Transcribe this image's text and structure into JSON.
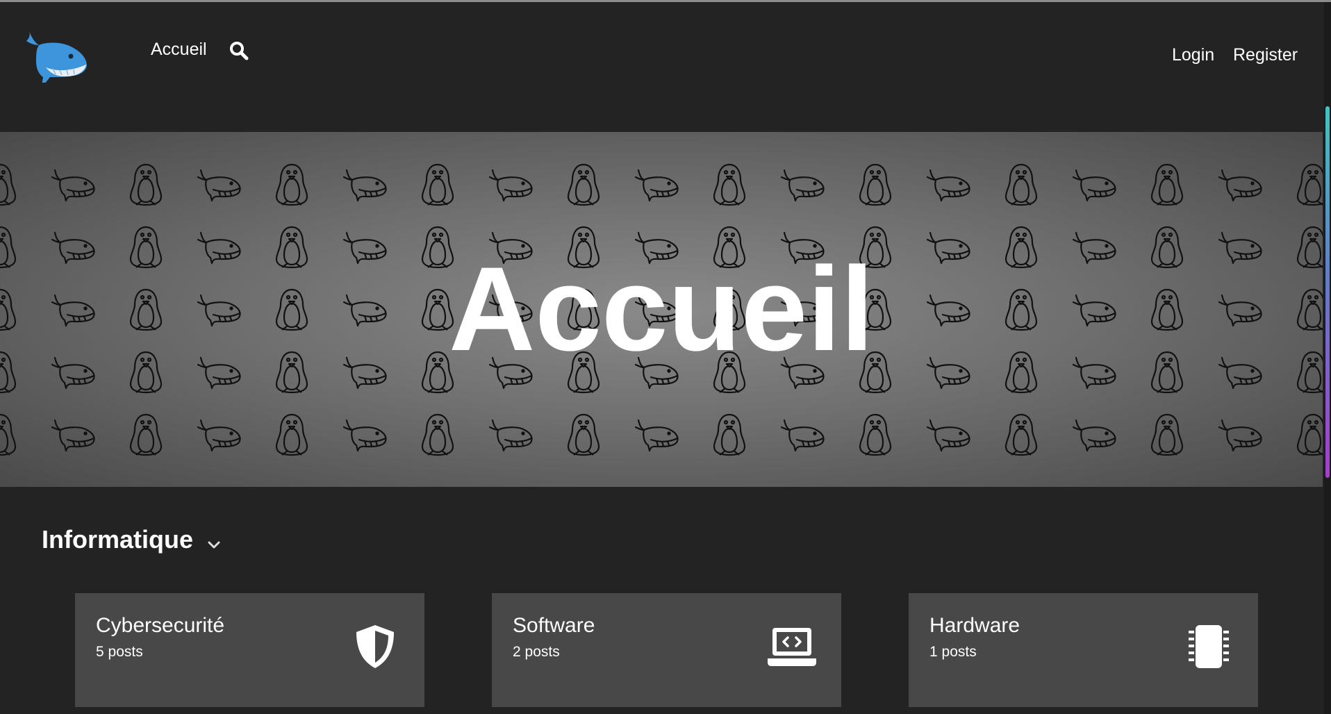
{
  "navbar": {
    "logo_icon": "whale-logo-icon",
    "home_label": "Accueil",
    "search_icon": "search-icon",
    "login_label": "Login",
    "register_label": "Register"
  },
  "hero": {
    "title": "Accueil",
    "pattern_icons": [
      "penguin-icon",
      "whale-icon"
    ]
  },
  "section": {
    "title": "Informatique",
    "toggle_icon": "chevron-down-icon"
  },
  "cards": [
    {
      "title": "Cybersecurité",
      "count": "5 posts",
      "icon": "shield-icon"
    },
    {
      "title": "Software",
      "count": "2 posts",
      "icon": "laptop-code-icon"
    },
    {
      "title": "Hardware",
      "count": "1 posts",
      "icon": "microchip-icon"
    }
  ],
  "colors": {
    "background": "#232323",
    "card": "#484848",
    "logo_blue": "#3d96dc",
    "scrollbar_accent": "#a83ccf"
  }
}
